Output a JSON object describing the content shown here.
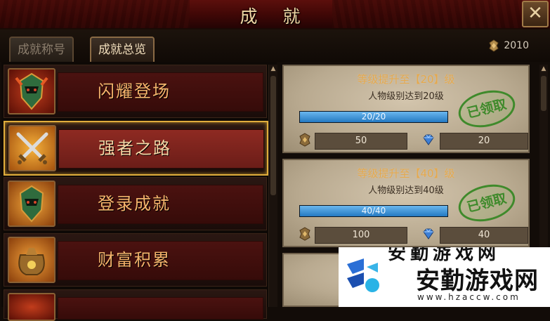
{
  "window": {
    "title": "成  就",
    "close_icon": "close-x-icon"
  },
  "tabs": [
    {
      "label": "成就称号",
      "active": false
    },
    {
      "label": "成就总览",
      "active": true
    }
  ],
  "currency": {
    "icon": "achievement-coin-icon",
    "value": "2010"
  },
  "categories": [
    {
      "label": "闪耀登场",
      "icon": "helmet-emblem-icon",
      "selected": false
    },
    {
      "label": "强者之路",
      "icon": "crossed-swords-icon",
      "selected": true
    },
    {
      "label": "登录成就",
      "icon": "helmet-emblem-icon",
      "selected": false
    },
    {
      "label": "财富积累",
      "icon": "money-bag-icon",
      "selected": false
    }
  ],
  "achievements": [
    {
      "title": "等级提升至【20】级",
      "desc": "人物级别达到20级",
      "progress_text": "20/20",
      "progress": 1.0,
      "stamp": "已领取",
      "reward_points": "50",
      "reward_gems": "20"
    },
    {
      "title": "等级提升至【40】级",
      "desc": "人物级别达到40级",
      "progress_text": "40/40",
      "progress": 1.0,
      "stamp": "已领取",
      "reward_points": "100",
      "reward_gems": "40"
    }
  ],
  "watermark": {
    "main": "安勤游戏网",
    "url": "www.hzaccw.com",
    "partial": "安勤游戏网"
  },
  "colors": {
    "accent_gold": "#e0ad3c",
    "progress_blue": "#2479c2",
    "stamp_green": "#3f8a2b"
  }
}
